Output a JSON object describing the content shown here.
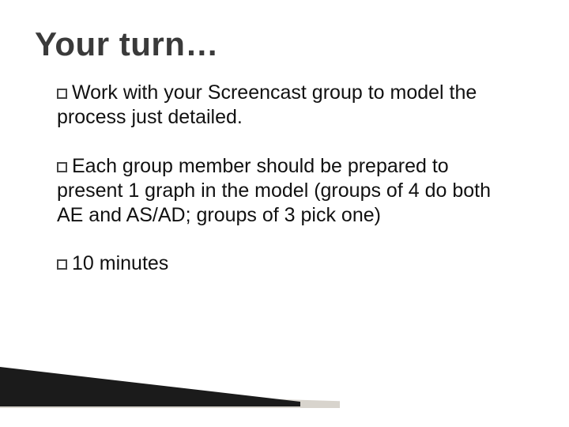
{
  "title": "Your turn…",
  "bullets": [
    {
      "first": "Work",
      "rest": " with your Screencast group to model the process just detailed."
    },
    {
      "first": "Each",
      "rest": " group member should be prepared to present 1 graph in the model (groups of 4 do both AE and AS/AD; groups of 3 pick one)"
    },
    {
      "first": "10",
      "rest": " minutes"
    }
  ]
}
